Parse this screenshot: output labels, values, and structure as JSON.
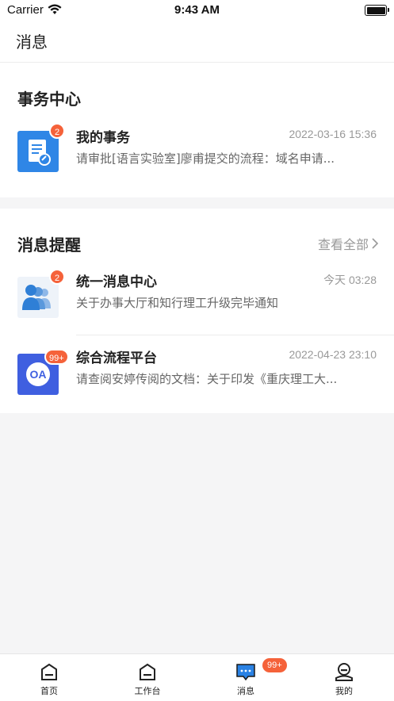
{
  "status_bar": {
    "carrier": "Carrier",
    "time": "9:43 AM"
  },
  "nav": {
    "title": "消息"
  },
  "affairs": {
    "title": "事务中心",
    "items": [
      {
        "name": "我的事务",
        "time": "2022-03-16 15:36",
        "preview": "请审批[语言实验室]廖甫提交的流程：域名申请...",
        "badge": "2",
        "icon": "document-approval-icon"
      }
    ]
  },
  "notify": {
    "title": "消息提醒",
    "view_all": "查看全部",
    "items": [
      {
        "name": "统一消息中心",
        "time": "今天 03:28",
        "preview": "关于办事大厅和知行理工升级完毕通知",
        "badge": "2",
        "icon": "users-group-icon"
      },
      {
        "name": "综合流程平台",
        "time": "2022-04-23 23:10",
        "preview": "请查阅安婷传阅的文档：关于印发《重庆理工大...",
        "badge": "99+",
        "icon": "oa-icon",
        "icon_text": "OA"
      }
    ]
  },
  "tab_bar": {
    "tabs": [
      {
        "label": "首页",
        "icon": "home-icon"
      },
      {
        "label": "工作台",
        "icon": "workbench-icon"
      },
      {
        "label": "消息",
        "icon": "message-icon",
        "badge": "99+"
      },
      {
        "label": "我的",
        "icon": "profile-icon"
      }
    ]
  },
  "colors": {
    "accent": "#2a82e4",
    "badge": "#f5623a",
    "oa_bg": "#3f5fe0"
  }
}
